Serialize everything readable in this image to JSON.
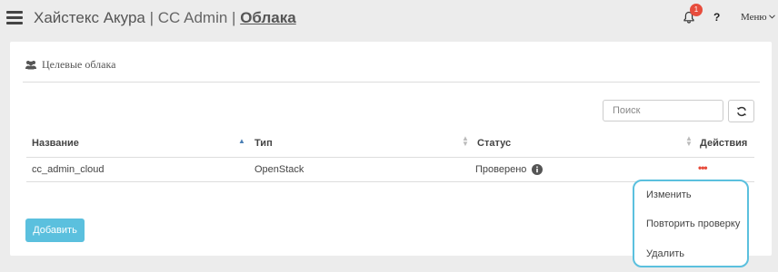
{
  "header": {
    "app_name": "Хайстекс Акура",
    "section": "CC Admin",
    "page": "Облака",
    "separator": "|",
    "notification_count": "1",
    "help_label": "?",
    "menu_label": "Меню"
  },
  "panel": {
    "title": "Целевые облака",
    "search_placeholder": "Поиск",
    "columns": [
      {
        "label": "Название",
        "sort": "asc"
      },
      {
        "label": "Тип",
        "sort": "none"
      },
      {
        "label": "Статус",
        "sort": "none"
      },
      {
        "label": "Действия",
        "sort": "none"
      }
    ],
    "rows": [
      {
        "name": "cc_admin_cloud",
        "type": "OpenStack",
        "status": "Проверено"
      }
    ],
    "actions_glyph": "•••",
    "add_button": "Добавить"
  },
  "actions_menu": {
    "items": [
      "Изменить",
      "Повторить проверку",
      "Удалить"
    ]
  },
  "colors": {
    "accent": "#5bc0de",
    "badge": "#e74c3c",
    "sort_active": "#4a7fb5"
  },
  "icons": {
    "menu": "hamburger-icon",
    "notifications": "bell-icon",
    "panel": "users-icon",
    "refresh": "refresh-icon",
    "status_info": "info-icon",
    "menu_caret": "chevron-down-icon"
  }
}
